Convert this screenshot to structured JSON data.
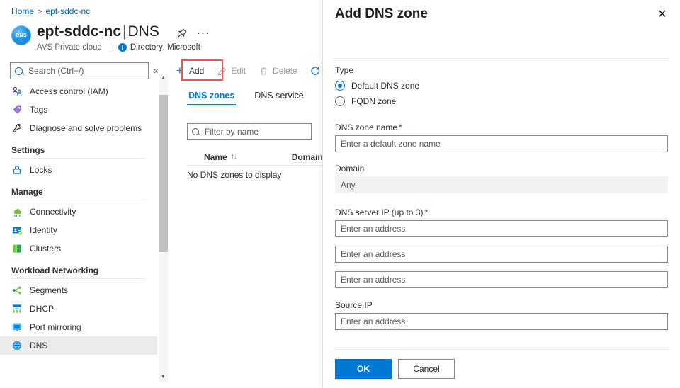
{
  "breadcrumb": {
    "home": "Home",
    "separator": ">",
    "current": "ept-sddc-nc"
  },
  "resource": {
    "icon_label": "DNS",
    "name": "ept-sddc-nc",
    "separator": "|",
    "section": "DNS",
    "type_label": "AVS Private cloud",
    "directory_label": "Directory: Microsoft",
    "info_glyph": "i",
    "pin_title": "Pin to dashboard",
    "more_glyph": "···"
  },
  "sidebar": {
    "search_placeholder": "Search (Ctrl+/)",
    "search_value": "",
    "collapse_glyph": "«",
    "items": [
      {
        "label": "Access control (IAM)",
        "icon": "access-control-icon",
        "selected": false
      },
      {
        "label": "Tags",
        "icon": "tag-icon",
        "selected": false
      },
      {
        "label": "Diagnose and solve problems",
        "icon": "wrench-icon",
        "selected": false
      }
    ],
    "groups": [
      {
        "label": "Settings",
        "items": [
          {
            "label": "Locks",
            "icon": "lock-icon",
            "selected": false
          }
        ]
      },
      {
        "label": "Manage",
        "items": [
          {
            "label": "Connectivity",
            "icon": "connectivity-icon",
            "selected": false
          },
          {
            "label": "Identity",
            "icon": "identity-icon",
            "selected": false
          },
          {
            "label": "Clusters",
            "icon": "clusters-icon",
            "selected": false
          }
        ]
      },
      {
        "label": "Workload Networking",
        "items": [
          {
            "label": "Segments",
            "icon": "segments-icon",
            "selected": false
          },
          {
            "label": "DHCP",
            "icon": "dhcp-icon",
            "selected": false
          },
          {
            "label": "Port mirroring",
            "icon": "port-mirroring-icon",
            "selected": false
          },
          {
            "label": "DNS",
            "icon": "dns-icon",
            "selected": true
          }
        ]
      }
    ]
  },
  "content": {
    "toolbar": {
      "add_label": "Add",
      "edit_label": "Edit",
      "delete_label": "Delete",
      "refresh_label": ""
    },
    "tabs": [
      {
        "label": "DNS zones",
        "active": true
      },
      {
        "label": "DNS service",
        "active": false
      }
    ],
    "filter_placeholder": "Filter by name",
    "filter_value": "",
    "table": {
      "columns": [
        "Name",
        "Domain"
      ],
      "sort_glyph": "↑↓",
      "rows": [],
      "empty_message": "No DNS zones to display"
    }
  },
  "panel": {
    "title": "Add DNS zone",
    "close_glyph": "✕",
    "type": {
      "label": "Type",
      "options": [
        {
          "label": "Default DNS zone",
          "selected": true
        },
        {
          "label": "FQDN zone",
          "selected": false
        }
      ]
    },
    "zone_name": {
      "label": "DNS zone name",
      "required_marker": "*",
      "placeholder": "Enter a default zone name",
      "value": ""
    },
    "domain": {
      "label": "Domain",
      "value": "Any"
    },
    "dns_server_ip": {
      "label": "DNS server IP (up to 3)",
      "required_marker": "*",
      "fields": [
        {
          "placeholder": "Enter an address",
          "value": ""
        },
        {
          "placeholder": "Enter an address",
          "value": ""
        },
        {
          "placeholder": "Enter an address",
          "value": ""
        }
      ]
    },
    "source_ip": {
      "label": "Source IP",
      "placeholder": "Enter an address",
      "value": ""
    },
    "footer": {
      "ok_label": "OK",
      "cancel_label": "Cancel"
    }
  },
  "colors": {
    "accent": "#0078d4",
    "link": "#0067b8",
    "highlight": "#f3554c",
    "required": "#a4262c",
    "selected_bg": "#edebe9"
  }
}
